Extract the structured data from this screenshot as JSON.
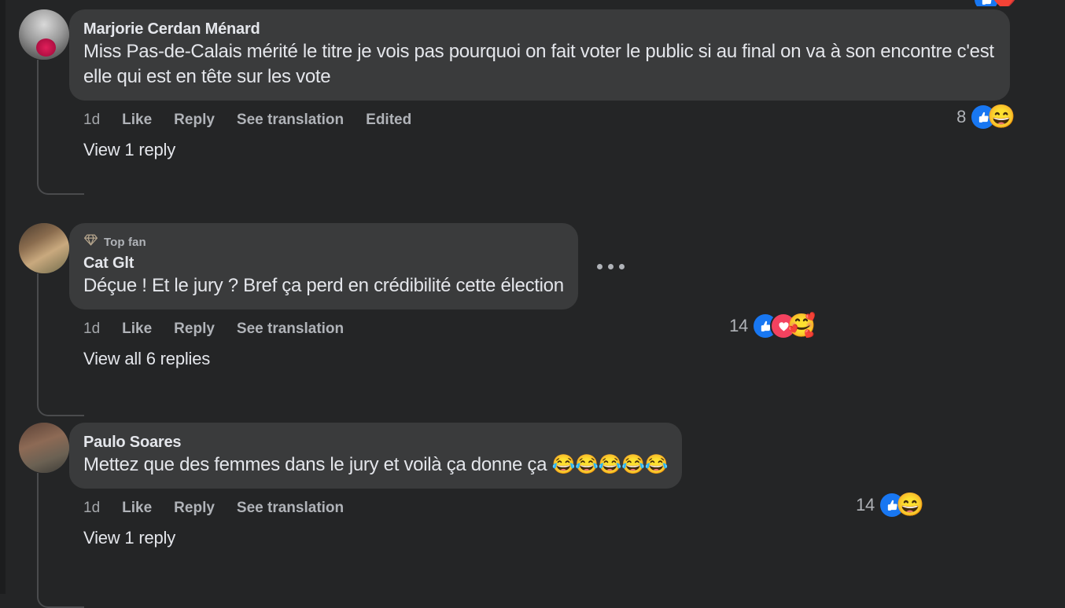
{
  "theme": {
    "page_background": "#242526",
    "bubble_background": "#3a3b3c",
    "primary_text": "#e4e6eb",
    "secondary_text": "#b0b3b8",
    "connector_line": "#4a4b4d",
    "like_blue": "#1877f2",
    "love_red": "#f3425f",
    "top_fan_badge": "#b5a58d"
  },
  "cutoff_row": {
    "reactions": [
      "like-reaction-icon",
      "love-reaction-icon"
    ]
  },
  "comments": [
    {
      "id": "comment-marjorie",
      "author": "Marjorie Cerdan Ménard",
      "avatar_name": "avatar-marjorie-cerdan-menard",
      "badge": null,
      "text": "Miss Pas-de-Calais mérité le titre je vois pas pourquoi on fait voter le public si au final on va à son encontre c'est elle qui est en tête sur les vote",
      "has_more_menu": false,
      "actions": [
        {
          "label": "1d",
          "name": "timestamp",
          "strong": false
        },
        {
          "label": "Like",
          "name": "like-button",
          "strong": true
        },
        {
          "label": "Reply",
          "name": "reply-button",
          "strong": true
        },
        {
          "label": "See translation",
          "name": "see-translation-button",
          "strong": true
        },
        {
          "label": "Edited",
          "name": "edited-label",
          "strong": true
        }
      ],
      "reactions": {
        "count": "8",
        "icons": [
          "like-reaction-icon",
          "haha-reaction-icon"
        ]
      },
      "view_replies": "View 1 reply"
    },
    {
      "id": "comment-cat-glt",
      "author": "Cat Glt",
      "avatar_name": "avatar-cat-glt",
      "badge": {
        "label": "Top fan",
        "icon": "diamond-icon"
      },
      "text": "Déçue ! Et le jury ? Bref ça perd en crédibilité cette élection",
      "has_more_menu": true,
      "more_menu_label": "more-options",
      "actions": [
        {
          "label": "1d",
          "name": "timestamp",
          "strong": false
        },
        {
          "label": "Like",
          "name": "like-button",
          "strong": true
        },
        {
          "label": "Reply",
          "name": "reply-button",
          "strong": true
        },
        {
          "label": "See translation",
          "name": "see-translation-button",
          "strong": true
        }
      ],
      "reactions": {
        "count": "14",
        "icons": [
          "like-reaction-icon",
          "love-reaction-icon",
          "care-reaction-icon"
        ]
      },
      "view_replies": "View all 6 replies"
    },
    {
      "id": "comment-paulo-soares",
      "author": "Paulo Soares",
      "avatar_name": "avatar-paulo-soares",
      "badge": null,
      "text": "Mettez que des femmes dans le jury et voilà ça donne ça 😂😂😂😂😂",
      "has_more_menu": false,
      "actions": [
        {
          "label": "1d",
          "name": "timestamp",
          "strong": false
        },
        {
          "label": "Like",
          "name": "like-button",
          "strong": true
        },
        {
          "label": "Reply",
          "name": "reply-button",
          "strong": true
        },
        {
          "label": "See translation",
          "name": "see-translation-button",
          "strong": true
        }
      ],
      "reactions": {
        "count": "14",
        "icons": [
          "like-reaction-icon",
          "haha-reaction-icon"
        ]
      },
      "view_replies": "View 1 reply"
    }
  ]
}
